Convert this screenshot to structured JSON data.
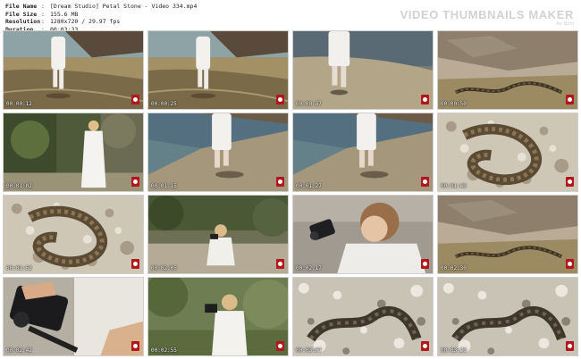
{
  "meta": {
    "rows": [
      {
        "key": "File Name",
        "value": "[Dream Studio] Petal Stone - Video 334.mp4"
      },
      {
        "key": "File Size",
        "value": "155.6 MB"
      },
      {
        "key": "Resolution",
        "value": "1280x720 / 29.97 fps"
      },
      {
        "key": "Duration",
        "value": "00:03:33"
      }
    ]
  },
  "brand": {
    "title": "VIDEO THUMBNAILS MAKER",
    "by": "by Nimi"
  },
  "thumbnails": [
    {
      "time": "00:00:12",
      "scene": "woman-walking-shallow-water"
    },
    {
      "time": "00:00:25",
      "scene": "woman-walking-shallow-water"
    },
    {
      "time": "00:00:37",
      "scene": "legs-walking-water"
    },
    {
      "time": "00:00:50",
      "scene": "snake-on-rocks"
    },
    {
      "time": "00:01:02",
      "scene": "woman-in-white-with-bushes"
    },
    {
      "time": "00:01:15",
      "scene": "legs-on-shore"
    },
    {
      "time": "00:01:27",
      "scene": "legs-on-shore"
    },
    {
      "time": "00:01:40",
      "scene": "snake-closeup-pebbles"
    },
    {
      "time": "00:01:52",
      "scene": "snake-closeup-pebbles"
    },
    {
      "time": "00:02:05",
      "scene": "woman-with-camera-crouching"
    },
    {
      "time": "00:02:17",
      "scene": "woman-filming-closeup"
    },
    {
      "time": "00:02:30",
      "scene": "snake-on-rocks"
    },
    {
      "time": "00:02:42",
      "scene": "camera-closeup-hands"
    },
    {
      "time": "00:02:55",
      "scene": "woman-filming-greenery"
    },
    {
      "time": "00:03:07",
      "scene": "snake-on-shells"
    },
    {
      "time": "00:03:20",
      "scene": "snake-on-shells"
    }
  ]
}
